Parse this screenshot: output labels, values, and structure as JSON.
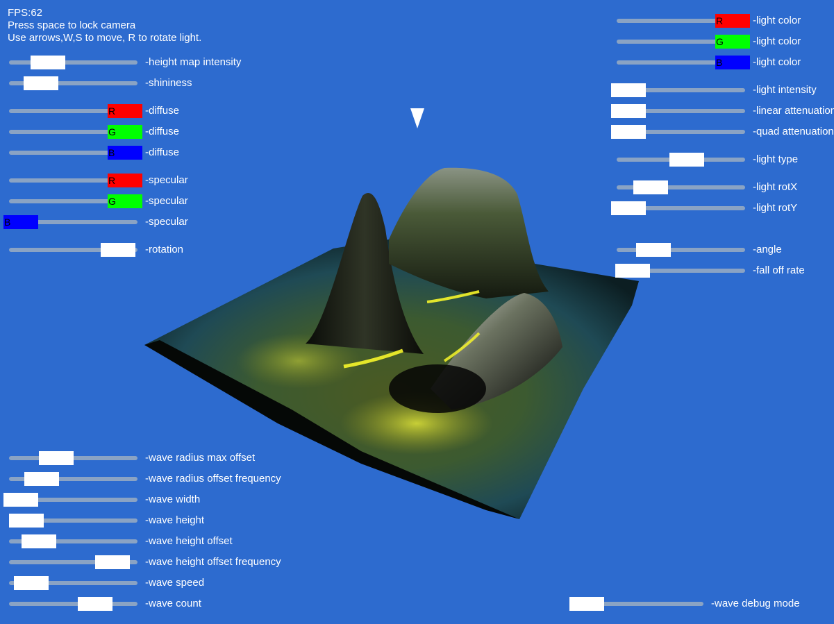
{
  "info": {
    "fps": "FPS:62",
    "line1": "Press space to lock camera",
    "line2": "Use arrows,W,S to move, R to rotate light."
  },
  "left_sliders": [
    {
      "label": "-height map intensity",
      "value": 0.26,
      "color": "",
      "letter": ""
    },
    {
      "label": "-shininess",
      "value": 0.19,
      "color": "",
      "letter": ""
    },
    {
      "label": "-diffuse",
      "value": 1.0,
      "color": "r",
      "letter": "R"
    },
    {
      "label": "-diffuse",
      "value": 1.0,
      "color": "g",
      "letter": "G"
    },
    {
      "label": "-diffuse",
      "value": 1.0,
      "color": "b",
      "letter": "B"
    },
    {
      "label": "-specular",
      "value": 1.0,
      "color": "r",
      "letter": "R"
    },
    {
      "label": "-specular",
      "value": 1.0,
      "color": "g",
      "letter": "G"
    },
    {
      "label": "-specular",
      "value": 0.0,
      "color": "b",
      "letter": "B"
    },
    {
      "label": "-rotation",
      "value": 0.93,
      "color": "",
      "letter": ""
    }
  ],
  "right_sliders": [
    {
      "label": "-light color",
      "value": 1.0,
      "color": "r",
      "letter": "R"
    },
    {
      "label": "-light color",
      "value": 1.0,
      "color": "g",
      "letter": "G"
    },
    {
      "label": "-light color",
      "value": 1.0,
      "color": "b",
      "letter": "B"
    },
    {
      "label": "-light intensity",
      "value": 0.0,
      "color": "",
      "letter": ""
    },
    {
      "label": "-linear attenuation",
      "value": 0.0,
      "color": "",
      "letter": ""
    },
    {
      "label": "-quad attenuation",
      "value": 0.0,
      "color": "",
      "letter": ""
    },
    {
      "label": "-light type",
      "value": 0.56,
      "color": "",
      "letter": ""
    },
    {
      "label": "-light rotX",
      "value": 0.21,
      "color": "",
      "letter": ""
    },
    {
      "label": "-light rotY",
      "value": 0.0,
      "color": "",
      "letter": ""
    },
    {
      "label": "-angle",
      "value": 0.24,
      "color": "",
      "letter": ""
    },
    {
      "label": "-fall off rate",
      "value": 0.04,
      "color": "",
      "letter": ""
    }
  ],
  "wave_sliders": [
    {
      "label": "-wave radius max offset",
      "value": 0.34,
      "color": "",
      "letter": ""
    },
    {
      "label": "-wave radius offset frequency",
      "value": 0.2,
      "color": "",
      "letter": ""
    },
    {
      "label": "-wave width",
      "value": 0.0,
      "color": "",
      "letter": ""
    },
    {
      "label": "-wave height",
      "value": 0.05,
      "color": "",
      "letter": ""
    },
    {
      "label": "-wave height offset",
      "value": 0.17,
      "color": "",
      "letter": ""
    },
    {
      "label": "-wave height offset frequency",
      "value": 0.88,
      "color": "",
      "letter": ""
    },
    {
      "label": "-wave speed",
      "value": 0.1,
      "color": "",
      "letter": ""
    },
    {
      "label": "-wave count",
      "value": 0.71,
      "color": "",
      "letter": ""
    }
  ],
  "debug_slider": {
    "label": "-wave debug mode",
    "value": 0.0,
    "color": "",
    "letter": ""
  },
  "colors": {
    "background": "#2d6bcf",
    "track": "#8aa3c4",
    "thumb": "#ffffff",
    "red": "#ff0000",
    "green": "#00ff00",
    "blue": "#0000ff"
  }
}
